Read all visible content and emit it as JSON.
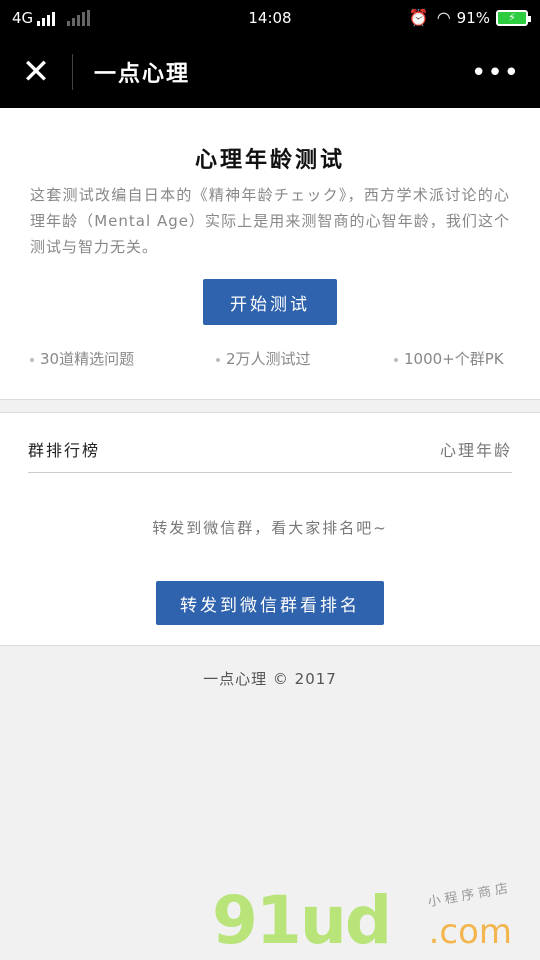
{
  "status": {
    "network": "4G",
    "time": "14:08",
    "battery_percent": "91%"
  },
  "nav": {
    "close_icon": "close-icon",
    "title": "一点心理",
    "more_icon": "more-dots-icon"
  },
  "intro": {
    "title": "心理年龄测试",
    "description": "这套测试改编自日本的《精神年龄チェック》，西方学术派讨论的心理年龄（Mental Age）实际上是用来测智商的心智年龄，我们这个测试与智力无关。",
    "start_button": "开始测试",
    "stats": [
      "30道精选问题",
      "2万人测试过",
      "1000+个群PK"
    ]
  },
  "ranking": {
    "label": "群排行榜",
    "column": "心理年龄",
    "empty_text": "转发到微信群，看大家排名吧~",
    "share_button": "转发到微信群看排名"
  },
  "footer": {
    "text": "一点心理 © 2017"
  },
  "watermark": {
    "main": "91ud",
    "suffix": ".com",
    "tag": "小程序商店"
  }
}
